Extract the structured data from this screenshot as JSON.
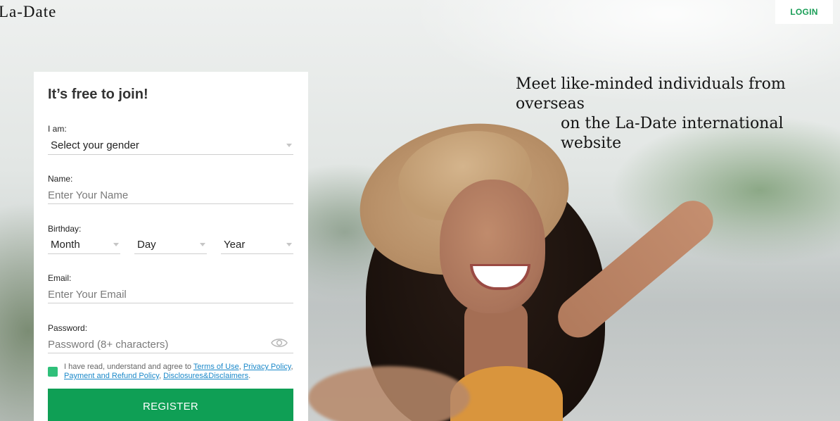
{
  "header": {
    "logo": "La-Date",
    "login_label": "LOGIN"
  },
  "hero": {
    "tagline_line1": "Meet like-minded individuals from overseas",
    "tagline_line2": "on the La-Date international website"
  },
  "form": {
    "title": "It’s free to join!",
    "gender": {
      "label": "I am:",
      "value": "Select your gender"
    },
    "name": {
      "label": "Name:",
      "placeholder": "Enter Your Name"
    },
    "birthday": {
      "label": "Birthday:",
      "month": "Month",
      "day": "Day",
      "year": "Year"
    },
    "email": {
      "label": "Email:",
      "placeholder": "Enter Your Email"
    },
    "password": {
      "label": "Password:",
      "placeholder": "Password (8+ characters)"
    },
    "terms": {
      "prefix": "I have read, understand and agree to ",
      "link1": "Terms of Use",
      "sep1": ", ",
      "link2": "Privacy Policy",
      "sep2": ", ",
      "link3": "Payment and Refund Policy",
      "sep3": ", ",
      "link4": "Disclosures&Disclaimers",
      "suffix": "."
    },
    "register_label": "REGISTER"
  },
  "colors": {
    "accent_green": "#0f9f55",
    "checkbox_green": "#2fc07a",
    "link_blue": "#1a88c9"
  },
  "icons": [
    "eye-icon",
    "chevron-down-icon"
  ]
}
